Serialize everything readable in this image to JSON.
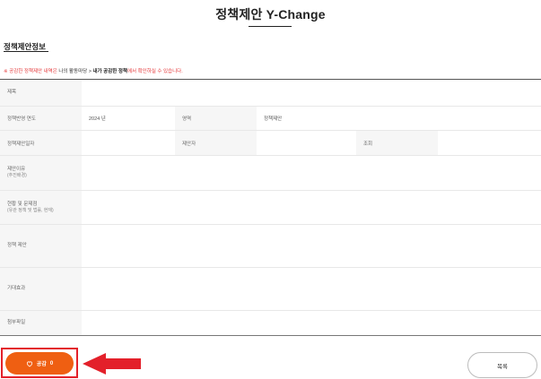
{
  "header": {
    "title": "정책제안 Y-Change"
  },
  "section": {
    "title": "정책제안정보"
  },
  "notice": {
    "prefix": "※ 공감한 정책제안 내역은 ",
    "path": "나의 활동마당 > ",
    "highlight": "내가 공감한 정책",
    "suffix": "에서 확인하실 수 있습니다."
  },
  "form": {
    "subject_label": "제목",
    "year_label": "정책반영 연도",
    "year_value": "2024 년",
    "field_label": "영역",
    "field_value": "정책제안",
    "date_label": "정책제안일자",
    "proposer_label": "제안자",
    "views_label": "조회",
    "reason_label": "제안이유",
    "reason_sub": "(추진배경)",
    "status_label": "현황 및 문제점",
    "status_sub": "(유관 정책 및 법률, 현재)",
    "proposal_label": "정책 제안",
    "effect_label": "기대효과",
    "attachment_label": "첨부파일"
  },
  "actions": {
    "like_label": "공감",
    "like_count": "0",
    "list_label": "목록"
  },
  "colors": {
    "accent": "#ef5f12",
    "highlight_border": "#e3202a",
    "notice_red": "#e5393b"
  },
  "icons": {
    "like": "heart-outline-icon",
    "pointer": "left-arrow-icon"
  }
}
